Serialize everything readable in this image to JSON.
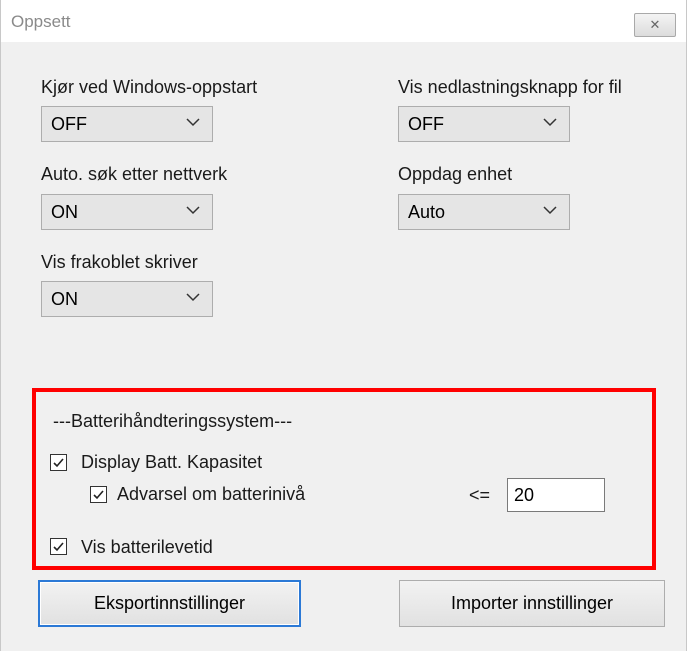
{
  "window": {
    "title": "Oppsett",
    "close_glyph": "✕"
  },
  "settings": {
    "run_on_startup": {
      "label": "Kjør ved Windows-oppstart",
      "value": "OFF"
    },
    "show_download_button": {
      "label": "Vis nedlastningsknapp for fil",
      "value": "OFF"
    },
    "auto_search_network": {
      "label": "Auto. søk etter nettverk",
      "value": "ON"
    },
    "detect_device": {
      "label": "Oppdag enhet",
      "value": "Auto"
    },
    "show_offline_printer": {
      "label": "Vis frakoblet skriver",
      "value": "ON"
    }
  },
  "battery": {
    "heading": "---Batterihåndteringssystem---",
    "display_capacity": {
      "label": "Display Batt. Kapasitet",
      "checked": true
    },
    "level_warning": {
      "label": "Advarsel om batterinivå",
      "checked": true
    },
    "operator": "<=",
    "threshold": "20",
    "show_lifetime": {
      "label": "Vis batterilevetid",
      "checked": true
    }
  },
  "buttons": {
    "export": "Eksportinnstillinger",
    "import": "Importer innstillinger"
  },
  "colors": {
    "highlight": "#ff0000",
    "focus": "#2b79d6",
    "dialog_bg": "#f0f0f0"
  }
}
